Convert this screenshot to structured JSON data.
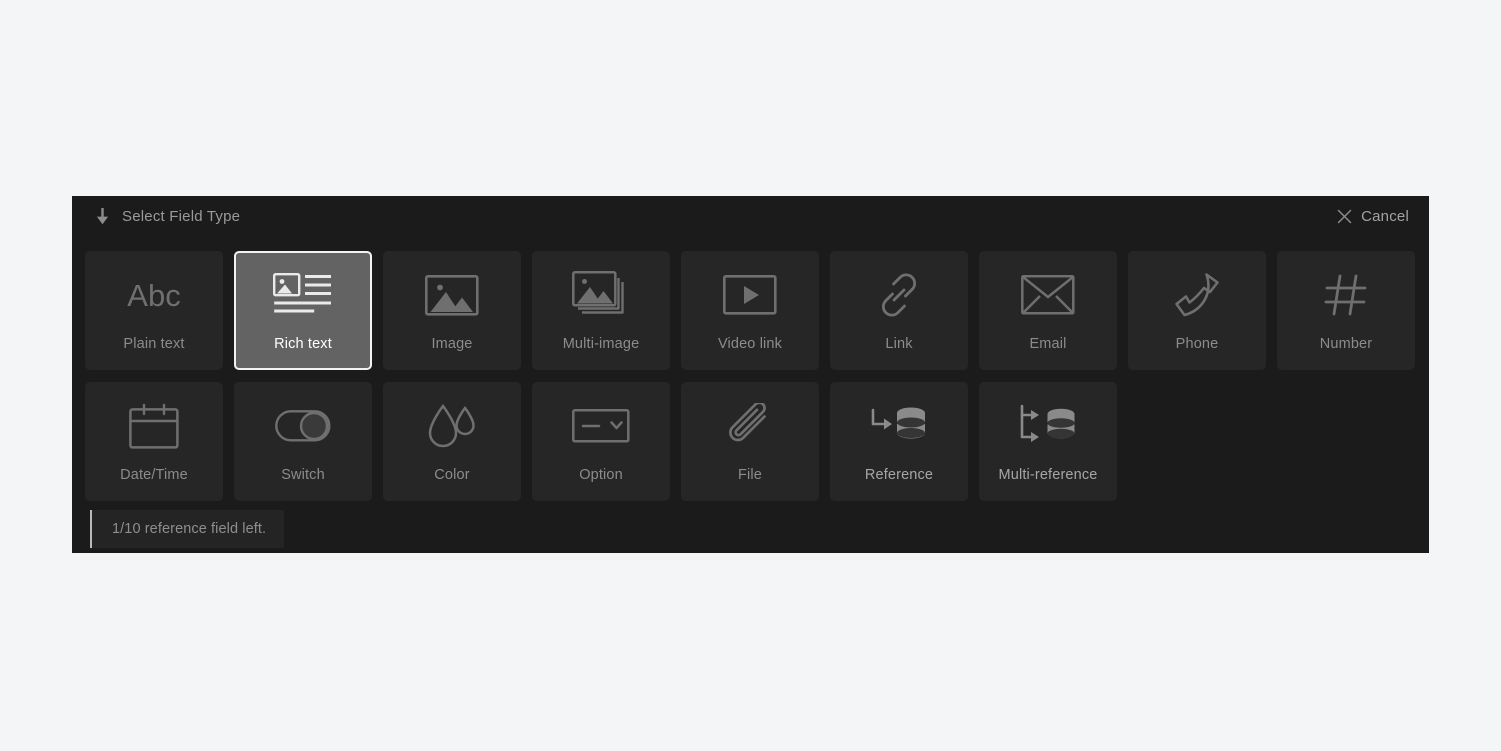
{
  "panel": {
    "header": {
      "arrow_icon": "arrow-down-icon",
      "title": "Select Field Type",
      "close_icon": "close-icon",
      "cancel_label": "Cancel"
    },
    "tiles": [
      {
        "label": "Plain text",
        "icon": "abc-icon",
        "selected": false
      },
      {
        "label": "Rich text",
        "icon": "rich-text-icon",
        "selected": true
      },
      {
        "label": "Image",
        "icon": "image-icon",
        "selected": false
      },
      {
        "label": "Multi-image",
        "icon": "multi-image-icon",
        "selected": false
      },
      {
        "label": "Video link",
        "icon": "video-link-icon",
        "selected": false
      },
      {
        "label": "Link",
        "icon": "link-icon",
        "selected": false
      },
      {
        "label": "Email",
        "icon": "email-icon",
        "selected": false
      },
      {
        "label": "Phone",
        "icon": "phone-icon",
        "selected": false
      },
      {
        "label": "Number",
        "icon": "number-icon",
        "selected": false
      },
      {
        "label": "Date/Time",
        "icon": "calendar-icon",
        "selected": false
      },
      {
        "label": "Switch",
        "icon": "switch-icon",
        "selected": false
      },
      {
        "label": "Color",
        "icon": "color-drops-icon",
        "selected": false
      },
      {
        "label": "Option",
        "icon": "dropdown-icon",
        "selected": false
      },
      {
        "label": "File",
        "icon": "paperclip-icon",
        "selected": false
      },
      {
        "label": "Reference",
        "icon": "reference-icon",
        "selected": false
      },
      {
        "label": "Multi-reference",
        "icon": "multi-reference-icon",
        "selected": false
      }
    ],
    "notice": {
      "text": "1/10 reference field left."
    }
  },
  "colors": {
    "page_background": "#f4f5f7",
    "panel_background": "#1b1b1b",
    "tile_background": "#262626",
    "tile_selected_background": "#636363",
    "tile_selected_border": "#f2f2f2",
    "label_text": "#8c8c8c",
    "selected_label_text": "#ffffff"
  }
}
